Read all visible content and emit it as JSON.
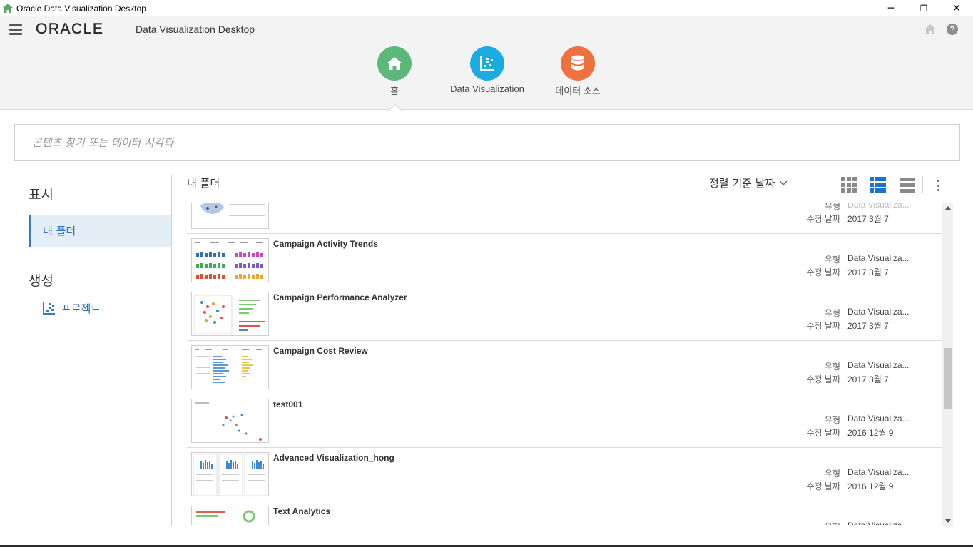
{
  "window": {
    "title": "Oracle Data Visualization Desktop",
    "minimize": "─",
    "maximize": "❐",
    "close": "✕"
  },
  "header": {
    "logo": "ORACLE",
    "product": "Data Visualization Desktop",
    "help": "?",
    "nav": [
      {
        "label": "홈",
        "color": "#5cb87a",
        "icon": "home-icon"
      },
      {
        "label": "Data Visualization",
        "color": "#1aabe0",
        "icon": "scatter-chart-icon"
      },
      {
        "label": "데이터 소스",
        "color": "#f07040",
        "icon": "database-icon"
      }
    ]
  },
  "search": {
    "placeholder": "콘텐츠 찾기 또는 데이터 시각화"
  },
  "sidebar": {
    "display_heading": "표시",
    "my_folder": "내 폴더",
    "create_heading": "생성",
    "project": "프로젝트"
  },
  "main": {
    "title": "내 폴더",
    "sort_label": "정렬 기준 날짜",
    "type_label": "유형",
    "modified_label": "수정 날짜",
    "items": [
      {
        "name": "",
        "type": "Data Visualiza...",
        "modified": "2017 3월 7"
      },
      {
        "name": "Campaign Activity Trends",
        "type": "Data Visualiza...",
        "modified": "2017 3월 7"
      },
      {
        "name": "Campaign Performance Analyzer",
        "type": "Data Visualiza...",
        "modified": "2017 3월 7"
      },
      {
        "name": "Campaign Cost Review",
        "type": "Data Visualiza...",
        "modified": "2017 3월 7"
      },
      {
        "name": "test001",
        "type": "Data Visualiza...",
        "modified": "2016 12월 9"
      },
      {
        "name": "Advanced Visualization_hong",
        "type": "Data Visualiza...",
        "modified": "2016 12월 9"
      },
      {
        "name": "Text Analytics",
        "type": "Data Visualiza...",
        "modified": ""
      }
    ]
  },
  "colors": {
    "accent": "#2e7cc4",
    "home_green": "#5cb87a",
    "dv_blue": "#1aabe0",
    "ds_orange": "#f07040"
  }
}
